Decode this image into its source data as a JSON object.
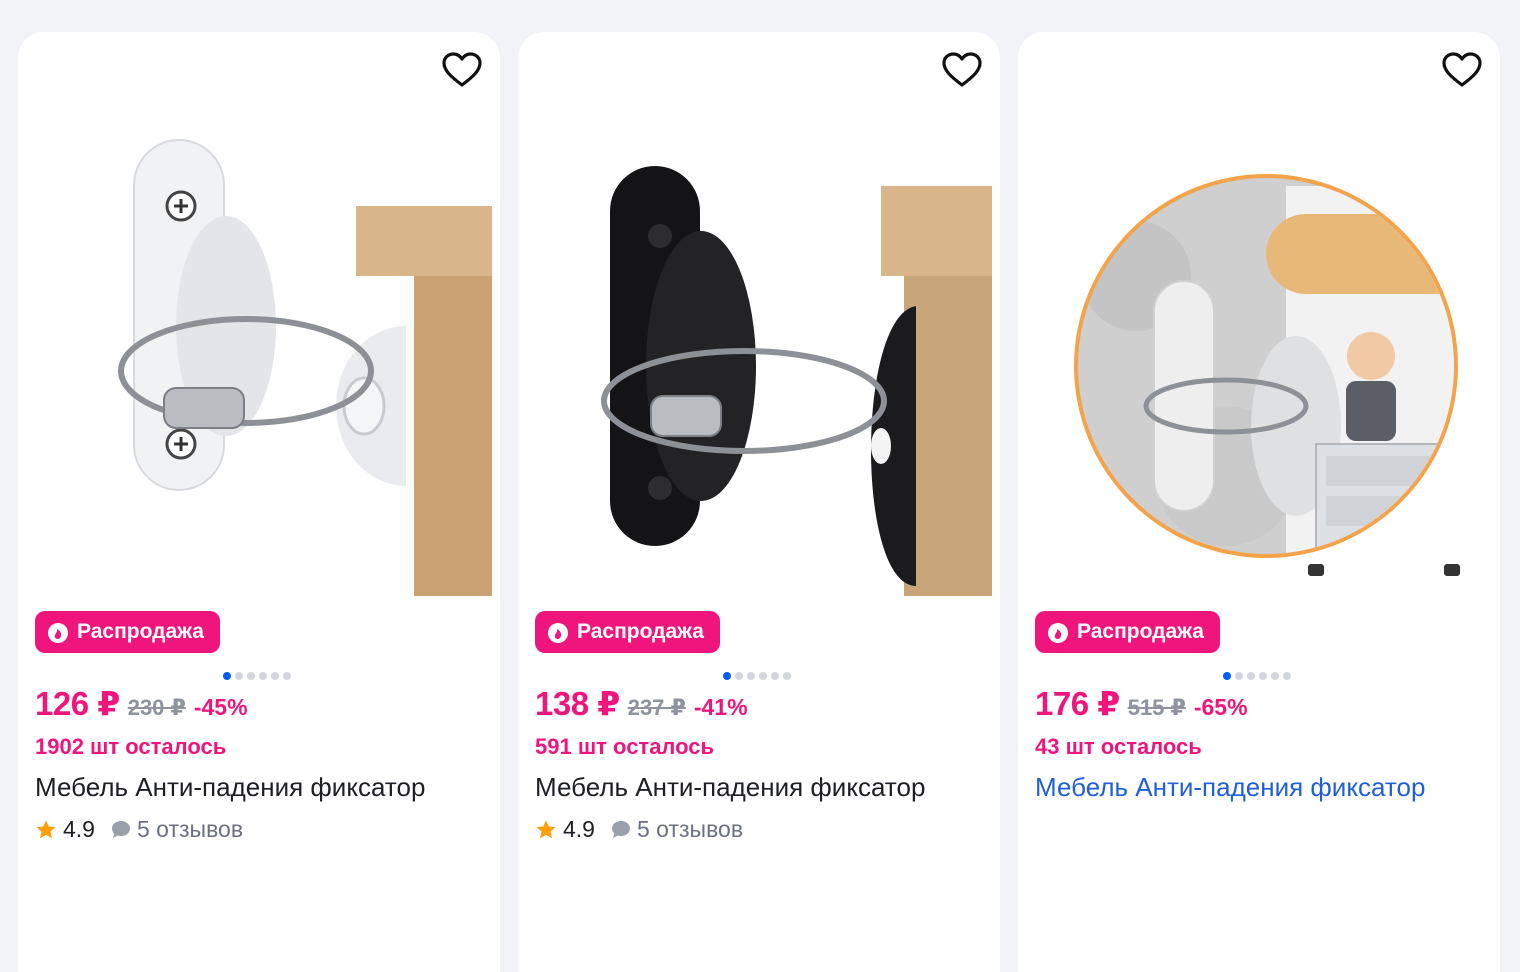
{
  "products": [
    {
      "badge": "Распродажа",
      "price": "126 ₽",
      "old_price": "230 ₽",
      "discount": "-45%",
      "stock": "1902 шт осталось",
      "title": "Мебель Анти-падения фиксатор",
      "rating": "4.9",
      "reviews": "5 отзывов",
      "image_variant": "white-bracket-with-wood",
      "dots": 6,
      "active_dot": 0
    },
    {
      "badge": "Распродажа",
      "price": "138 ₽",
      "old_price": "237 ₽",
      "discount": "-41%",
      "stock": "591 шт осталось",
      "title": "Мебель Анти-падения фиксатор",
      "rating": "4.9",
      "reviews": "5 отзывов",
      "image_variant": "black-bracket-with-wood",
      "dots": 6,
      "active_dot": 0
    },
    {
      "badge": "Распродажа",
      "price": "176 ₽",
      "old_price": "515 ₽",
      "discount": "-65%",
      "stock": "43 шт осталось",
      "title": "Мебель Анти-падения фиксатор",
      "image_variant": "circle-photo-child-dresser",
      "dots": 6,
      "active_dot": 0
    }
  ],
  "colors": {
    "accent_pink": "#f0157c",
    "link_blue": "#1f5fd9",
    "active_dot": "#005bff",
    "star": "#ff9f0a"
  },
  "icons": [
    "heart-icon",
    "flame-icon",
    "star-icon",
    "comment-icon"
  ]
}
